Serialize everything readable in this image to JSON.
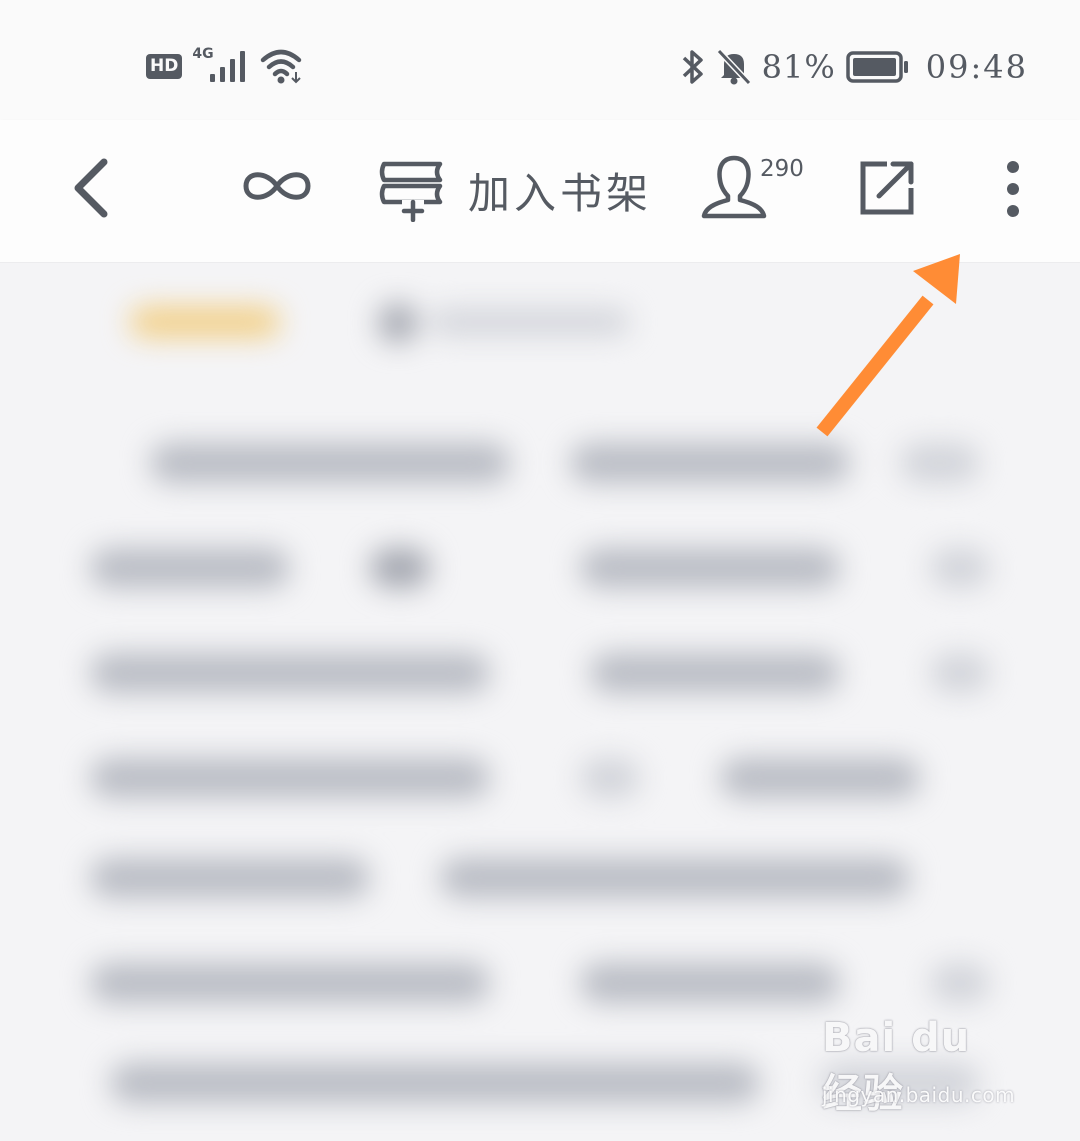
{
  "status_bar": {
    "hd_badge": "HD",
    "network_type": "4G",
    "icons": [
      "signal-icon",
      "wifi-icon",
      "bluetooth-icon",
      "bell-muted-icon",
      "battery-icon"
    ],
    "battery_percent": "81%",
    "battery_level": 0.81,
    "time": "09:48"
  },
  "toolbar": {
    "back_icon": "chevron-left-icon",
    "infinity_icon": "infinity-icon",
    "add_to_shelf_icon": "bookshelf-add-icon",
    "add_to_shelf_label": "加入书架",
    "user_icon": "user-icon",
    "user_count": "290",
    "share_icon": "share-icon",
    "more_icon": "more-vertical-icon"
  },
  "content": {
    "blurred": true
  },
  "annotation": {
    "arrow_color": "#ff8c35",
    "points_to": "more-button"
  },
  "watermark": {
    "brand": "Bai du 经验",
    "url": "jingyan.baidu.com"
  },
  "colors": {
    "icon": "#555a62",
    "background": "#f4f4f6",
    "toolbar_bg": "#fdfdfd",
    "tag": "#f2cf86"
  }
}
